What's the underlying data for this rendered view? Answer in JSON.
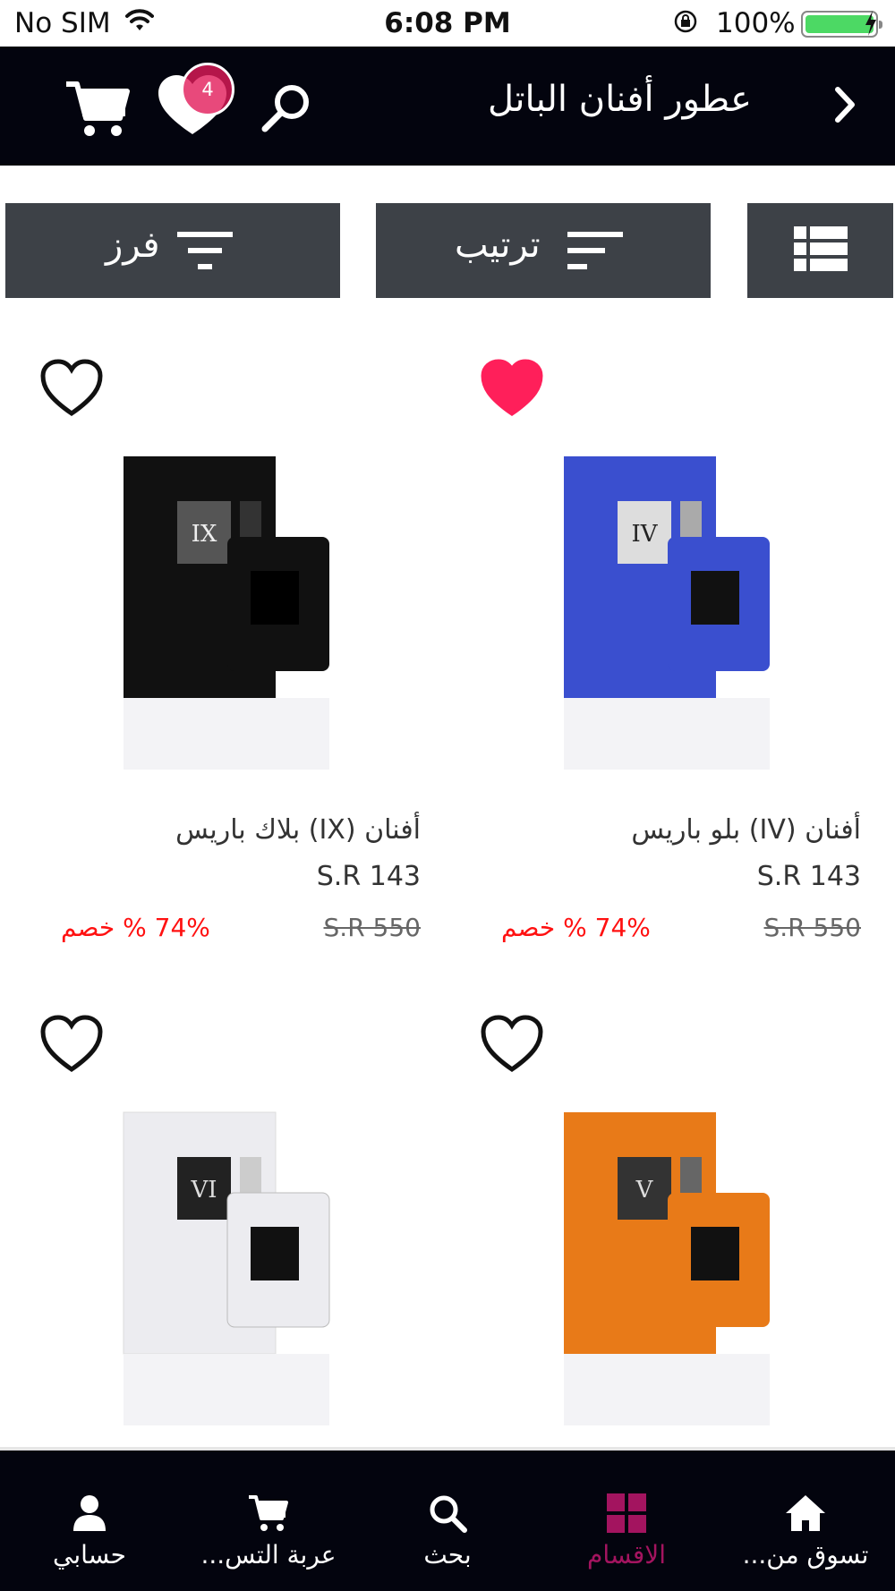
{
  "status_bar": {
    "carrier": "No SIM",
    "time": "6:08 PM",
    "battery_percent": "100%",
    "battery_level": 1.0,
    "battery_color": "#4cd964"
  },
  "header": {
    "title": "عطور أفنان الباتل",
    "wishlist_count": "4",
    "icons": [
      "chevron-right-icon",
      "search-icon",
      "heart-icon",
      "cart-icon"
    ],
    "background": "#03040e",
    "badge_color": "#e21b5a"
  },
  "toolbar": {
    "filter_label": "فرز",
    "sort_label": "ترتيب",
    "background": "#3d4147"
  },
  "products": [
    {
      "name": "أفنان (IV) بلو باريس",
      "price": "S.R 143",
      "old_price": "S.R 550",
      "discount": "74% % خصم",
      "favorited": true,
      "box_color": "#3a4fcf",
      "roman": "IV"
    },
    {
      "name": "أفنان (IX) بلاك باريس",
      "price": "S.R 143",
      "old_price": "S.R 550",
      "discount": "74% % خصم",
      "favorited": false,
      "box_color": "#111111",
      "roman": "IX"
    },
    {
      "name": "",
      "price": "",
      "old_price": "",
      "discount": "",
      "favorited": false,
      "box_color": "#e87a18",
      "roman": "V"
    },
    {
      "name": "",
      "price": "",
      "old_price": "",
      "discount": "",
      "favorited": false,
      "box_color": "#ececf0",
      "roman": "VI"
    }
  ],
  "tabbar": {
    "items": [
      {
        "label": "تسوق من...",
        "icon": "home-icon"
      },
      {
        "label": "الاقسام",
        "icon": "grid-icon"
      },
      {
        "label": "بحث",
        "icon": "search-icon"
      },
      {
        "label": "عربة التس...",
        "icon": "cart-icon"
      },
      {
        "label": "حسابي",
        "icon": "user-icon"
      }
    ],
    "active_color": "#a3145f"
  }
}
